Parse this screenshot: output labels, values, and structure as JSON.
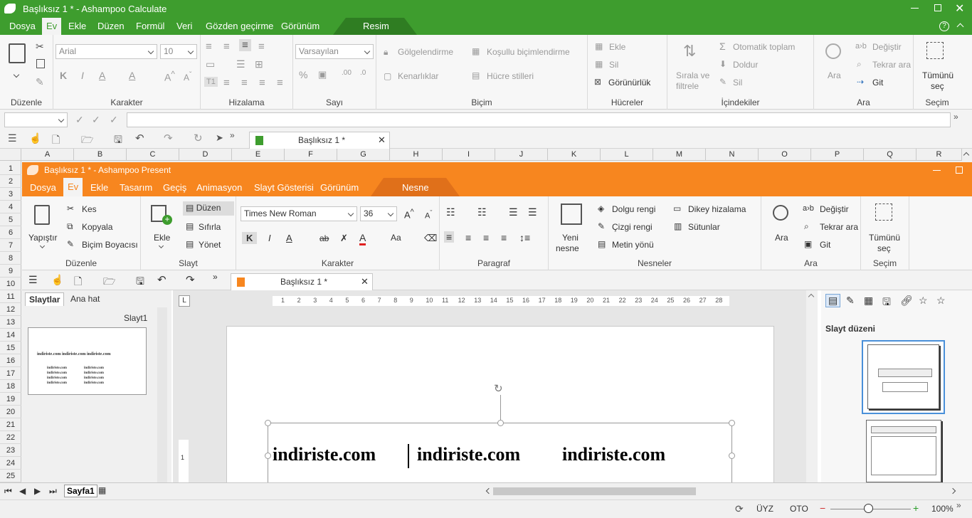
{
  "calc": {
    "title": "Başlıksız 1 * - Ashampoo Calculate",
    "menu": [
      "Dosya",
      "Ev",
      "Ekle",
      "Düzen",
      "Formül",
      "Veri",
      "Gözden geçirme",
      "Görünüm",
      "Resim"
    ],
    "ribbon": {
      "font_name": "Arial",
      "font_size": "10",
      "number_format": "Varsayılan",
      "shading": "Gölgelendirme",
      "conditional": "Koşullu biçimlendirme",
      "borders": "Kenarlıklar",
      "cell_styles": "Hücre stilleri",
      "insert": "Ekle",
      "delete": "Sil",
      "visibility": "Görünürlük",
      "sort_line1": "Sırala ve",
      "sort_line2": "filtrele",
      "autosum": "Otomatik toplam",
      "fill": "Doldur",
      "delete2": "Sil",
      "search": "Ara",
      "replace": "Değiştir",
      "search_again": "Tekrar ara",
      "goto": "Git",
      "select_all_line1": "Tümünü",
      "select_all_line2": "seç",
      "groups": [
        "Düzenle",
        "Karakter",
        "Hizalama",
        "Sayı",
        "Biçim",
        "Hücreler",
        "İçindekiler",
        "Ara",
        "Seçim"
      ]
    },
    "doc_tab": "Başlıksız 1 *",
    "columns": [
      "A",
      "B",
      "C",
      "D",
      "E",
      "F",
      "G",
      "H",
      "I",
      "J",
      "K",
      "L",
      "M",
      "N",
      "O",
      "P",
      "Q",
      "R"
    ],
    "rows": [
      "1",
      "2",
      "3",
      "4",
      "5",
      "6",
      "7",
      "8",
      "9",
      "10",
      "11",
      "12",
      "13",
      "14",
      "15",
      "16",
      "17",
      "18",
      "19",
      "20",
      "21",
      "22",
      "23",
      "24",
      "25"
    ],
    "sheet_tab": "Sayfa1",
    "status": {
      "insert_mode": "ÜYZ",
      "auto": "OTO",
      "zoom": "100%"
    }
  },
  "present": {
    "title": "Başlıksız 1 * - Ashampoo Present",
    "menu": [
      "Dosya",
      "Ev",
      "Ekle",
      "Tasarım",
      "Geçiş",
      "Animasyon",
      "Slayt Gösterisi",
      "Görünüm",
      "Nesne"
    ],
    "ribbon": {
      "paste": "Yapıştır",
      "cut": "Kes",
      "copy": "Kopyala",
      "format_painter": "Biçim Boyacısı",
      "add": "Ekle",
      "layout": "Düzen",
      "reset": "Sıfırla",
      "manage": "Yönet",
      "font_name": "Times New Roman",
      "font_size": "36",
      "new_object_line1": "Yeni",
      "new_object_line2": "nesne",
      "fill_color": "Dolgu rengi",
      "line_color": "Çizgi rengi",
      "text_direction": "Metin yönü",
      "vertical_align": "Dikey hizalama",
      "columns": "Sütunlar",
      "search": "Ara",
      "replace": "Değiştir",
      "search_again": "Tekrar ara",
      "goto": "Git",
      "select_all_line1": "Tümünü",
      "select_all_line2": "seç",
      "groups": [
        "Düzenle",
        "Slayt",
        "Karakter",
        "Paragraf",
        "Nesneler",
        "Ara",
        "Seçim"
      ]
    },
    "doc_tab": "Başlıksız 1 *",
    "pane_tabs": [
      "Slaytlar",
      "Ana hat"
    ],
    "slide_label": "Slayt1",
    "thumb_title": "indiriste.com indiriste.com indiriste.com",
    "thumb_col1": [
      "indiriste.com",
      "indiriste.com",
      "indiriste.com",
      "indiriste.com"
    ],
    "thumb_col2": [
      "indiriste.com",
      "indiriste.com",
      "indiriste.com",
      "indiriste.com"
    ],
    "ruler": [
      "1",
      "2",
      "3",
      "4",
      "5",
      "6",
      "7",
      "8",
      "9",
      "10",
      "11",
      "12",
      "13",
      "14",
      "15",
      "16",
      "17",
      "18",
      "19",
      "20",
      "21",
      "22",
      "23",
      "24",
      "25",
      "26",
      "27",
      "28"
    ],
    "slide_text": [
      "indiriste.com",
      "indiriste.com",
      "indiriste.com"
    ],
    "vruler_mark": "1",
    "layout_panel_title": "Slayt düzeni"
  }
}
